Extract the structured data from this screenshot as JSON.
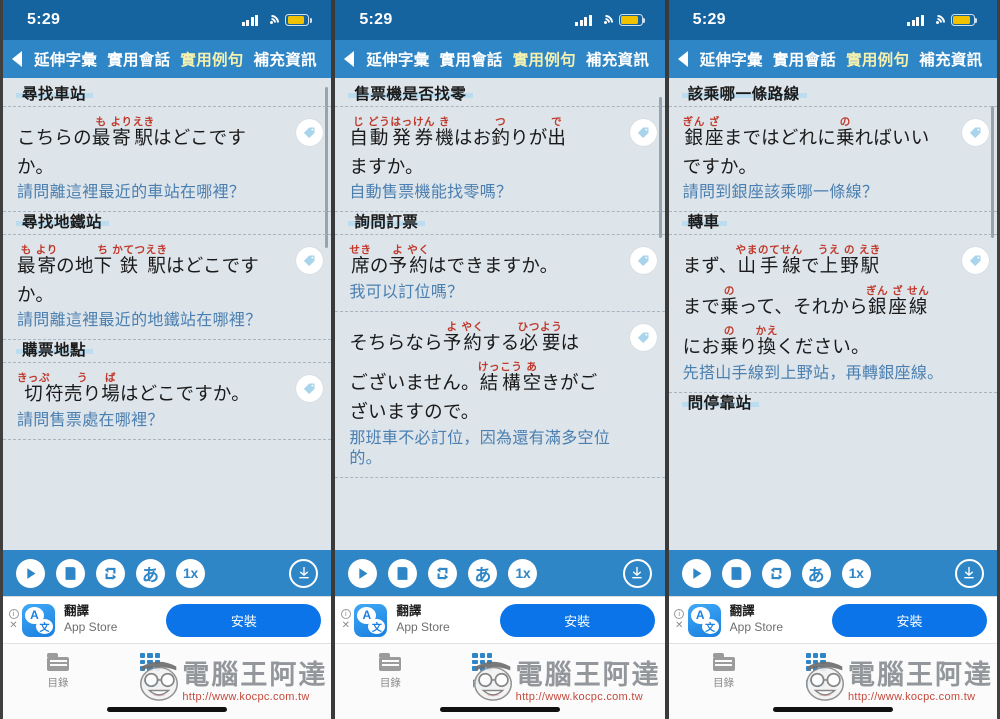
{
  "status_bar": {
    "time": "5:29",
    "signal_icon": "signal-bars-icon",
    "wifi_icon": "wifi-icon",
    "battery_icon": "battery-icon"
  },
  "nav": {
    "back_icon": "back-arrow-icon",
    "tabs": [
      {
        "label": "延伸字彙",
        "active": false
      },
      {
        "label": "實用會話",
        "active": false
      },
      {
        "label": "實用例句",
        "active": true
      },
      {
        "label": "補充資訊",
        "active": false
      }
    ]
  },
  "player": {
    "play_label": "play-icon",
    "list_label": "script-icon",
    "repeat_label": "repeat-icon",
    "kana_label": "あ",
    "speed_label": "1x",
    "download_label": "download-icon"
  },
  "ad": {
    "info_mark": "i",
    "close_mark": "✕",
    "icon_letter_a": "A",
    "icon_letter_zh": "文",
    "title": "翻譯",
    "subtitle": "App Store",
    "cta": "安裝"
  },
  "tabbar": {
    "items": [
      {
        "label": "目錄",
        "icon": "folder-icon",
        "selected": false
      },
      {
        "label": "內容",
        "icon": "grid-icon",
        "selected": true
      }
    ]
  },
  "watermark": {
    "name": "電腦王阿達",
    "url": "http://www.kocpc.com.tw"
  },
  "panels": [
    {
      "id": "panel-1",
      "scroll": {
        "top_pct": 2,
        "height_pct": 34
      },
      "sections": [
        {
          "title": "尋找車站",
          "entries": [
            {
              "lines": [
                {
                  "segments": [
                    {
                      "text": "こちらの",
                      "ruby": ""
                    },
                    {
                      "text": "最",
                      "ruby": "も"
                    },
                    {
                      "text": "寄",
                      "ruby": "より"
                    },
                    {
                      "text": "駅",
                      "ruby": "えき"
                    },
                    {
                      "text": "はどこです",
                      "ruby": ""
                    }
                  ]
                },
                {
                  "segments": [
                    {
                      "text": "か。",
                      "ruby": ""
                    }
                  ]
                }
              ],
              "zh": "請問離這裡最近的車站在哪裡？"
            }
          ]
        },
        {
          "title": "尋找地鐵站",
          "entries": [
            {
              "lines": [
                {
                  "segments": [
                    {
                      "text": "最",
                      "ruby": "も"
                    },
                    {
                      "text": "寄",
                      "ruby": "より"
                    },
                    {
                      "text": "の地",
                      "ruby": ""
                    },
                    {
                      "text": "下",
                      "ruby": "ち"
                    },
                    {
                      "text": "鉄",
                      "ruby": "かてつ"
                    },
                    {
                      "text": "駅",
                      "ruby": "えき"
                    },
                    {
                      "text": "はどこです",
                      "ruby": ""
                    }
                  ]
                },
                {
                  "segments": [
                    {
                      "text": "か。",
                      "ruby": ""
                    }
                  ]
                }
              ],
              "zh": "請問離這裡最近的地鐵站在哪裡？"
            }
          ]
        },
        {
          "title": "購票地點",
          "entries": [
            {
              "lines": [
                {
                  "segments": [
                    {
                      "text": "切",
                      "ruby": "きっぷ"
                    },
                    {
                      "text": "符",
                      "ruby": ""
                    },
                    {
                      "text": "売り",
                      "ruby": "う"
                    },
                    {
                      "text": "場",
                      "ruby": "ば"
                    },
                    {
                      "text": "はどこですか。",
                      "ruby": ""
                    }
                  ]
                }
              ],
              "zh": "請問售票處在哪裡？"
            }
          ]
        }
      ]
    },
    {
      "id": "panel-2",
      "scroll": {
        "top_pct": 4,
        "height_pct": 30
      },
      "sections": [
        {
          "title": "售票機是否找零",
          "entries": [
            {
              "lines": [
                {
                  "segments": [
                    {
                      "text": "自",
                      "ruby": "じ"
                    },
                    {
                      "text": "動",
                      "ruby": "どう"
                    },
                    {
                      "text": "発",
                      "ruby": "はっ"
                    },
                    {
                      "text": "券",
                      "ruby": "けん"
                    },
                    {
                      "text": "機",
                      "ruby": "き"
                    },
                    {
                      "text": "はお",
                      "ruby": ""
                    },
                    {
                      "text": "釣",
                      "ruby": "つ"
                    },
                    {
                      "text": "りが",
                      "ruby": ""
                    },
                    {
                      "text": "出",
                      "ruby": "で"
                    }
                  ]
                },
                {
                  "segments": [
                    {
                      "text": "ますか。",
                      "ruby": ""
                    }
                  ]
                }
              ],
              "zh": "自動售票機能找零嗎？"
            }
          ]
        },
        {
          "title": "詢問訂票",
          "entries": [
            {
              "lines": [
                {
                  "segments": [
                    {
                      "text": "席",
                      "ruby": "せき"
                    },
                    {
                      "text": "の",
                      "ruby": ""
                    },
                    {
                      "text": "予",
                      "ruby": "よ"
                    },
                    {
                      "text": "約",
                      "ruby": "やく"
                    },
                    {
                      "text": "はできますか。",
                      "ruby": ""
                    }
                  ]
                }
              ],
              "zh": "我可以訂位嗎？"
            },
            {
              "lines": [
                {
                  "segments": [
                    {
                      "text": "そちらなら",
                      "ruby": ""
                    },
                    {
                      "text": "予",
                      "ruby": "よ"
                    },
                    {
                      "text": "約",
                      "ruby": "やく"
                    },
                    {
                      "text": "する",
                      "ruby": ""
                    },
                    {
                      "text": "必",
                      "ruby": "ひつ"
                    },
                    {
                      "text": "要",
                      "ruby": "よう"
                    },
                    {
                      "text": "は",
                      "ruby": ""
                    }
                  ]
                },
                {
                  "segments": [
                    {
                      "text": "ございません。",
                      "ruby": ""
                    },
                    {
                      "text": "結",
                      "ruby": "けっ"
                    },
                    {
                      "text": "構",
                      "ruby": "こう"
                    },
                    {
                      "text": "空",
                      "ruby": "あ"
                    },
                    {
                      "text": "きがご",
                      "ruby": ""
                    }
                  ]
                },
                {
                  "segments": [
                    {
                      "text": "ざいますので。",
                      "ruby": ""
                    }
                  ]
                }
              ],
              "zh": "那班車不必訂位，因為還有滿多空位的。"
            }
          ]
        }
      ]
    },
    {
      "id": "panel-3",
      "scroll": {
        "top_pct": 6,
        "height_pct": 28
      },
      "sections": [
        {
          "title": "該乘哪一條路線",
          "entries": [
            {
              "lines": [
                {
                  "segments": [
                    {
                      "text": "銀",
                      "ruby": "ぎん"
                    },
                    {
                      "text": "座",
                      "ruby": "ざ"
                    },
                    {
                      "text": "まではどれに",
                      "ruby": ""
                    },
                    {
                      "text": "乗",
                      "ruby": "の"
                    },
                    {
                      "text": "ればいい",
                      "ruby": ""
                    }
                  ]
                },
                {
                  "segments": [
                    {
                      "text": "ですか。",
                      "ruby": ""
                    }
                  ]
                }
              ],
              "zh": "請問到銀座該乘哪一條線？"
            }
          ]
        },
        {
          "title": "轉車",
          "entries": [
            {
              "lines": [
                {
                  "segments": [
                    {
                      "text": "まず、",
                      "ruby": ""
                    },
                    {
                      "text": "山",
                      "ruby": "やま"
                    },
                    {
                      "text": "手",
                      "ruby": "のて"
                    },
                    {
                      "text": "線",
                      "ruby": "せん"
                    },
                    {
                      "text": "で",
                      "ruby": ""
                    },
                    {
                      "text": "上",
                      "ruby": "うえ"
                    },
                    {
                      "text": "野",
                      "ruby": "の"
                    },
                    {
                      "text": "駅",
                      "ruby": "えき"
                    }
                  ]
                },
                {
                  "segments": [
                    {
                      "text": "まで",
                      "ruby": ""
                    },
                    {
                      "text": "乗",
                      "ruby": "の"
                    },
                    {
                      "text": "って、それから",
                      "ruby": ""
                    },
                    {
                      "text": "銀",
                      "ruby": "ぎん"
                    },
                    {
                      "text": "座",
                      "ruby": "ざ"
                    },
                    {
                      "text": "線",
                      "ruby": "せん"
                    }
                  ]
                },
                {
                  "segments": [
                    {
                      "text": "にお",
                      "ruby": ""
                    },
                    {
                      "text": "乗",
                      "ruby": "の"
                    },
                    {
                      "text": "り",
                      "ruby": ""
                    },
                    {
                      "text": "換",
                      "ruby": "かえ"
                    },
                    {
                      "text": "ください。",
                      "ruby": ""
                    }
                  ]
                }
              ],
              "zh": "先搭山手線到上野站，再轉銀座線。"
            }
          ]
        },
        {
          "title": "問停靠站",
          "entries": []
        }
      ]
    }
  ]
}
